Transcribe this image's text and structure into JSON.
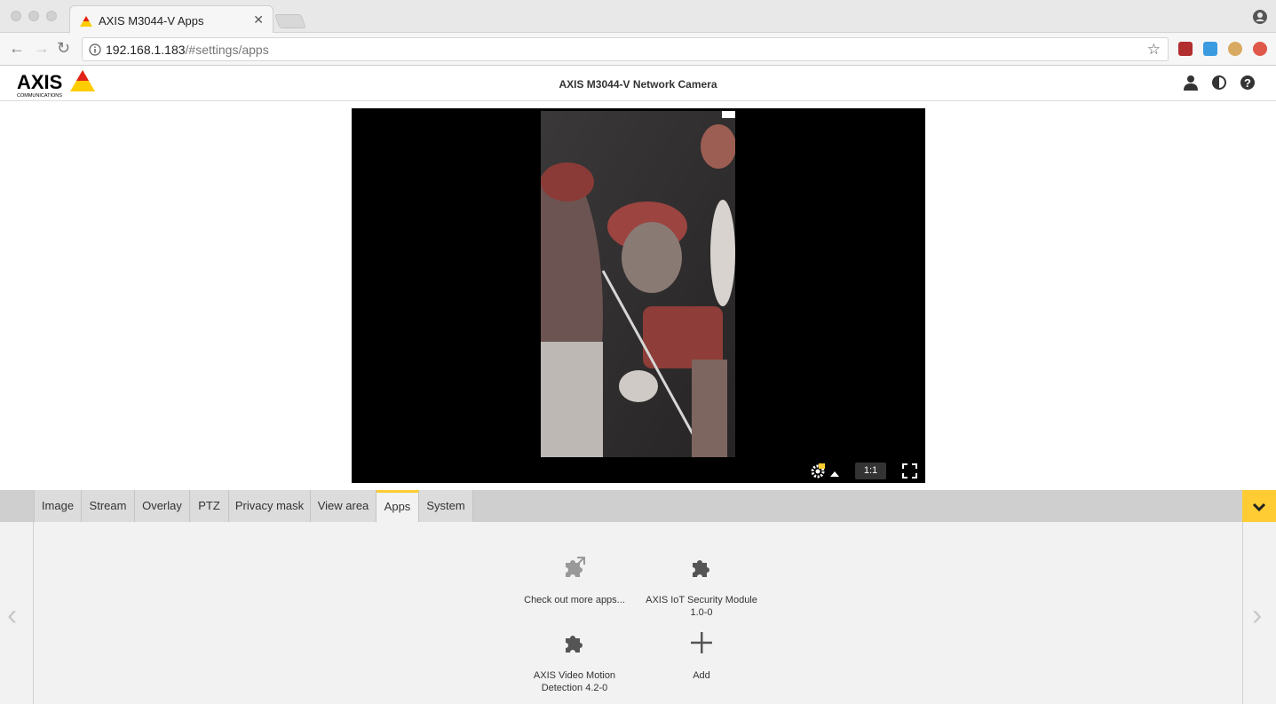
{
  "browser": {
    "tab_title": "AXIS M3044-V Apps",
    "url_host": "192.168.1.183",
    "url_path": "/#settings/apps"
  },
  "header": {
    "logo_text": "AXIS",
    "logo_subtext": "COMMUNICATIONS",
    "title": "AXIS M3044-V Network Camera"
  },
  "video": {
    "ratio_label": "1:1"
  },
  "tabs": [
    {
      "label": "Image"
    },
    {
      "label": "Stream"
    },
    {
      "label": "Overlay"
    },
    {
      "label": "PTZ"
    },
    {
      "label": "Privacy mask"
    },
    {
      "label": "View area"
    },
    {
      "label": "Apps",
      "active": true
    },
    {
      "label": "System"
    }
  ],
  "apps": [
    {
      "line1": "Check out more apps...",
      "line2": "",
      "icon": "puzzle-link-icon"
    },
    {
      "line1": "AXIS IoT Security Module",
      "line2": "1.0-0",
      "icon": "puzzle-icon"
    },
    {
      "line1": "AXIS Video Motion",
      "line2": "Detection  4.2-0",
      "icon": "puzzle-icon"
    },
    {
      "line1": "Add",
      "line2": "",
      "icon": "plus-icon"
    }
  ],
  "colors": {
    "accent": "#ffcc33"
  }
}
